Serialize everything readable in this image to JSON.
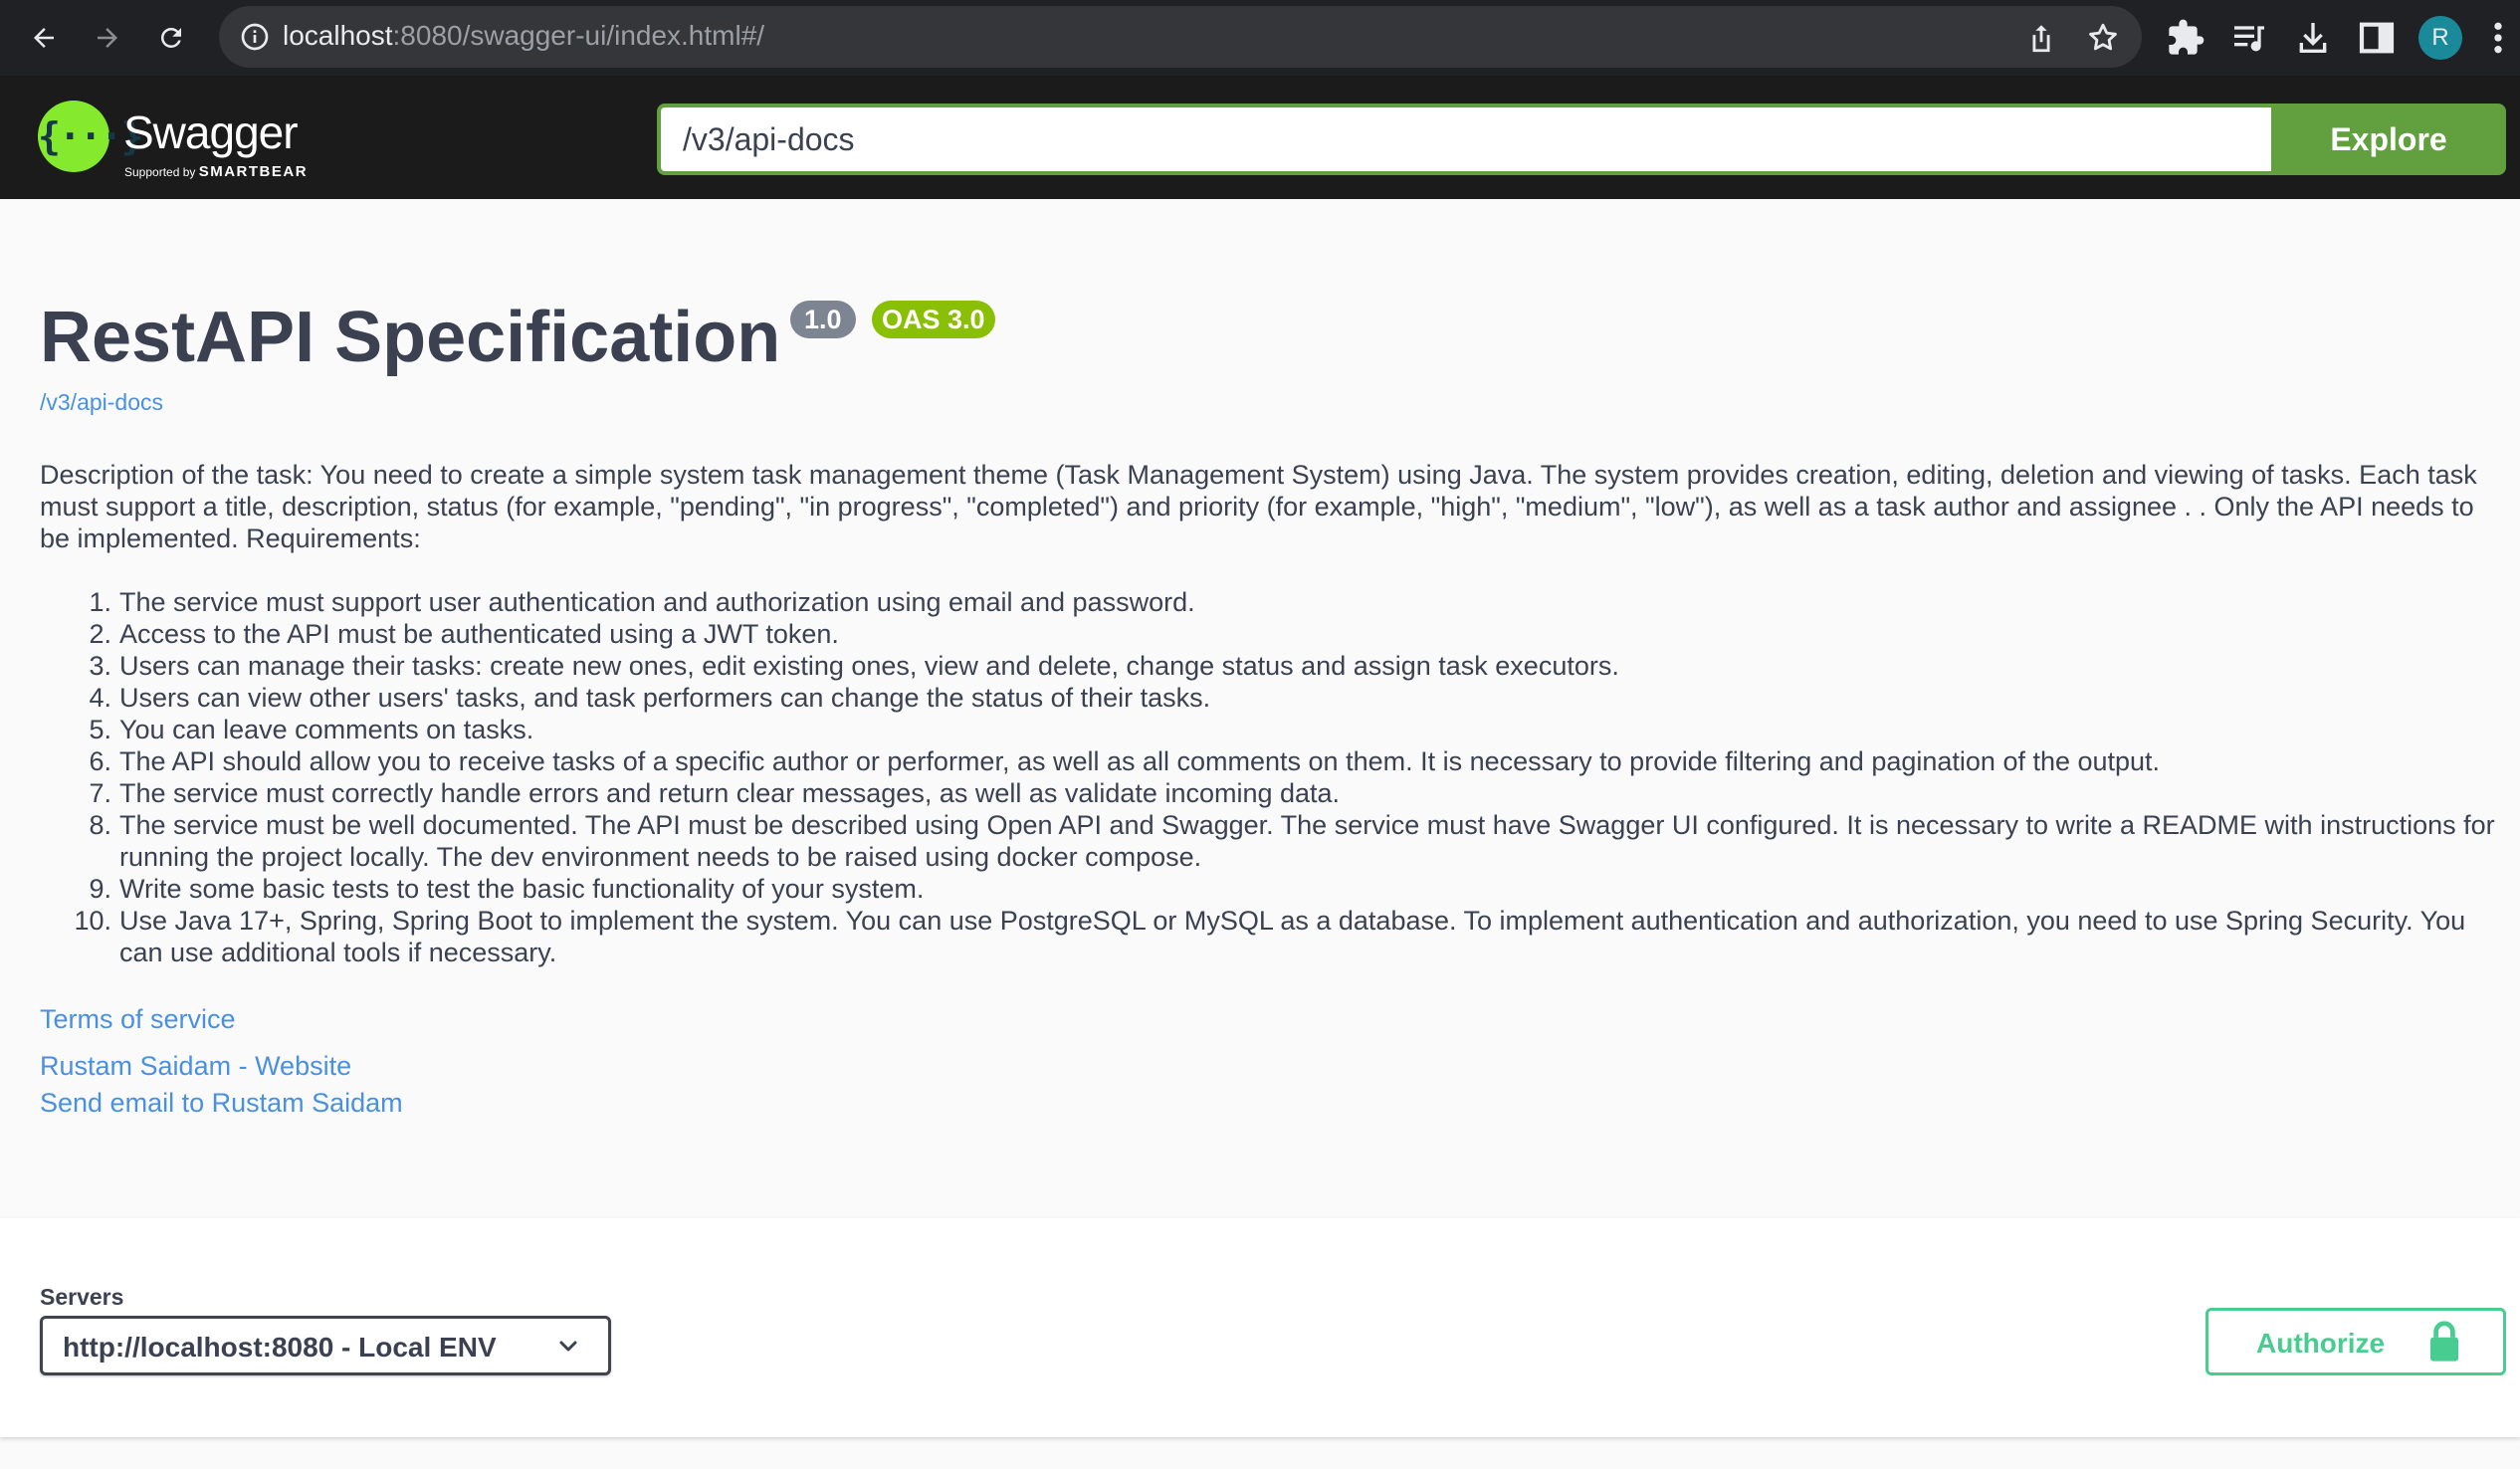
{
  "browser": {
    "url_host": "localhost",
    "url_rest": ":8080/swagger-ui/index.html#/",
    "avatar_letter": "R",
    "icons": [
      "back-icon",
      "forward-icon",
      "reload-icon",
      "site-info-icon",
      "share-icon",
      "bookmark-star-icon",
      "extensions-icon",
      "media-controls-icon",
      "download-icon",
      "side-panel-icon",
      "menu-icon"
    ]
  },
  "topbar": {
    "logo_name": "Swagger",
    "logo_supported": "Supported by ",
    "logo_company": "SMARTBEAR",
    "url_value": "/v3/api-docs",
    "explore_label": "Explore"
  },
  "info": {
    "title": "RestAPI Specification",
    "version": "1.0",
    "oas_version": "OAS 3.0",
    "spec_link": "/v3/api-docs",
    "description": "Description of the task: You need to create a simple system task management theme (Task Management System) using Java. The system provides creation, editing, deletion and viewing of tasks. Each task must support a title, description, status (for example, \"pending\", \"in progress\", \"completed\") and priority (for example, \"high\", \"medium\", \"low\"), as well as a task author and assignee . . Only the API needs to be implemented. Requirements:",
    "requirements": [
      {
        "num": "1.",
        "text": "The service must support user authentication and authorization using email and password."
      },
      {
        "num": "2.",
        "text": "Access to the API must be authenticated using a JWT token."
      },
      {
        "num": "3.",
        "text": "Users can manage their tasks: create new ones, edit existing ones, view and delete, change status and assign task executors."
      },
      {
        "num": "4.",
        "text": "Users can view other users' tasks, and task performers can change the status of their tasks."
      },
      {
        "num": "5.",
        "text": "You can leave comments on tasks."
      },
      {
        "num": "6.",
        "text": "The API should allow you to receive tasks of a specific author or performer, as well as all comments on them. It is necessary to provide filtering and pagination of the output."
      },
      {
        "num": "7.",
        "text": "The service must correctly handle errors and return clear messages, as well as validate incoming data."
      },
      {
        "num": "8.",
        "text": "The service must be well documented. The API must be described using Open API and Swagger. The service must have Swagger UI configured. It is necessary to write a README with instructions for running the project locally. The dev environment needs to be raised using docker compose."
      },
      {
        "num": "9.",
        "text": "Write some basic tests to test the basic functionality of your system."
      },
      {
        "num": "10.",
        "text": "Use Java 17+, Spring, Spring Boot to implement the system. You can use PostgreSQL or MySQL as a database. To implement authentication and authorization, you need to use Spring Security. You can use additional tools if necessary."
      }
    ],
    "terms_link": "Terms of service",
    "website_link": "Rustam Saidam - Website",
    "email_link": "Send email to Rustam Saidam"
  },
  "servers": {
    "label": "Servers",
    "selected": "http://localhost:8080 - Local ENV",
    "authorize_label": "Authorize"
  },
  "colors": {
    "topbar_bg": "#1b1b1b",
    "explore_green": "#62a03f",
    "logo_green": "#85ea2d",
    "link_blue": "#4990e2",
    "authorize_green": "#49cc90",
    "oas_badge": "#89bf04",
    "version_badge": "#7d8492",
    "text": "#3b4151"
  }
}
